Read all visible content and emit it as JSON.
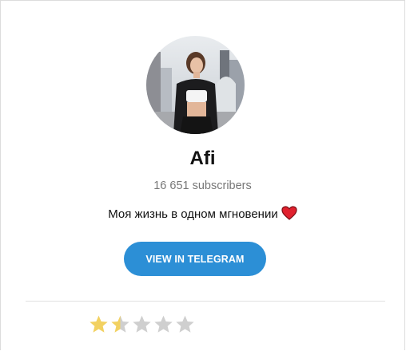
{
  "channel": {
    "name": "Afi",
    "subscribers": "16 651 subscribers",
    "description": "Моя жизнь в одном мгновении",
    "description_emoji": "heart-icon"
  },
  "actions": {
    "view_label": "VIEW IN TELEGRAM"
  },
  "rating": {
    "value": 1.5,
    "max": 5
  },
  "colors": {
    "button": "#2c8fd6",
    "star_filled": "#f2d161",
    "star_empty": "#cfcfcf",
    "heart": "#e0212e"
  }
}
